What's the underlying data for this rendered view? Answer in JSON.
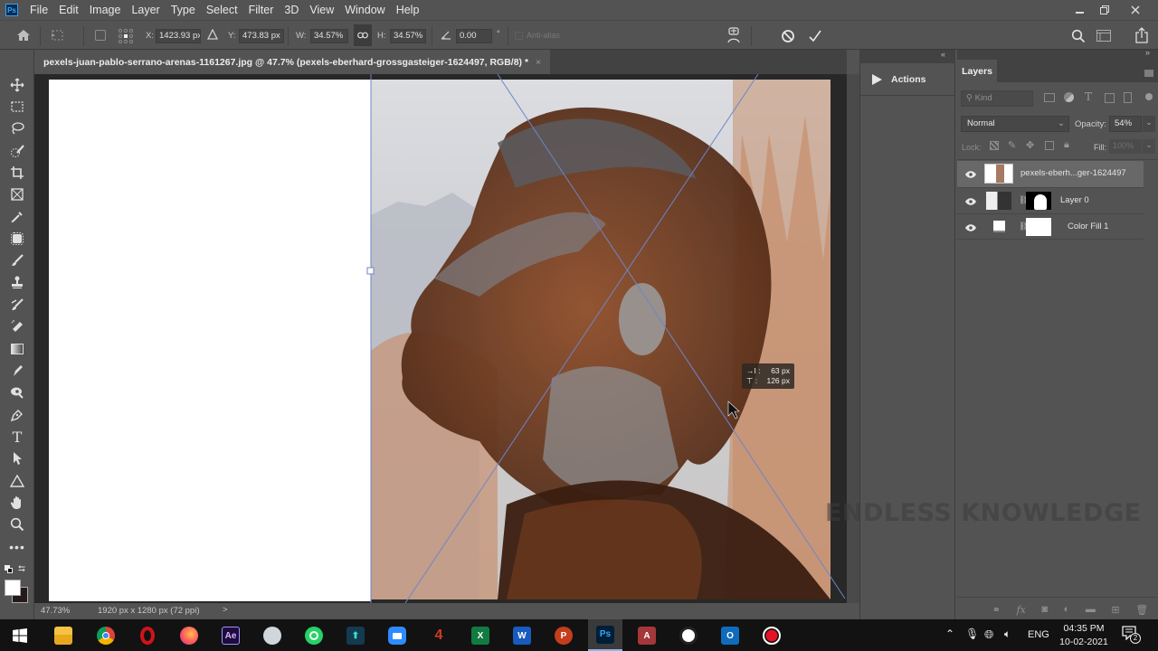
{
  "app": {
    "logo": "Ps",
    "menu": [
      "File",
      "Edit",
      "Image",
      "Layer",
      "Type",
      "Select",
      "Filter",
      "3D",
      "View",
      "Window",
      "Help"
    ],
    "window_controls": {
      "minimize": "minimize-icon",
      "restore": "restore-icon",
      "close": "close-icon"
    }
  },
  "options_bar": {
    "x_label": "X:",
    "x_value": "1423.93 px",
    "y_label": "Y:",
    "y_value": "473.83 px",
    "w_label": "W:",
    "w_value": "34.57%",
    "h_label": "H:",
    "h_value": "34.57%",
    "angle_value": "0.00",
    "angle_unit": "°",
    "anti_alias_label": "Anti-alias",
    "anti_alias_checked": false
  },
  "document": {
    "tab_title": "pexels-juan-pablo-serrano-arenas-1161267.jpg @ 47.7% (pexels-eberhard-grossgasteiger-1624497, RGB/8) *",
    "close_glyph": "×",
    "transform_tooltip": {
      "line1_label": "→I :",
      "line1_value": "63 px",
      "line2_label": "⊤ :",
      "line2_value": "126 px"
    }
  },
  "status_bar": {
    "zoom": "47.73%",
    "doc_size": "1920 px x 1280 px (72 ppi)",
    "arrow": ">"
  },
  "tools": [
    "move-tool",
    "marquee-tool",
    "lasso-tool",
    "quick-selection-tool",
    "crop-tool",
    "frame-tool",
    "eyedropper-tool",
    "spot-healing-tool",
    "brush-tool",
    "clone-stamp-tool",
    "history-brush-tool",
    "eraser-tool",
    "gradient-tool",
    "smudge-tool",
    "dodge-tool",
    "pen-tool",
    "type-tool",
    "path-selection-tool",
    "shape-tool",
    "hand-tool",
    "zoom-tool",
    "more-tools"
  ],
  "colors": {
    "foreground": "#ffffff",
    "background": "#231a1a",
    "accent_guide": "#6d86c8"
  },
  "actions_panel": {
    "title": "Actions"
  },
  "layers_panel": {
    "tab": "Layers",
    "filter_placeholder": "Kind",
    "blend_mode": "Normal",
    "opacity_label": "Opacity:",
    "opacity_value": "54%",
    "lock_label": "Lock:",
    "fill_label": "Fill:",
    "fill_value": "100%",
    "layers": [
      {
        "name": "pexels-eberh...ger-1624497",
        "visible": true,
        "selected": true,
        "type": "smart-object"
      },
      {
        "name": "Layer 0",
        "visible": true,
        "selected": false,
        "type": "masked"
      },
      {
        "name": "Color Fill 1",
        "visible": true,
        "selected": false,
        "type": "fill"
      }
    ],
    "footer_icons": [
      "link-icon",
      "fx-icon",
      "mask-icon",
      "adjustment-icon",
      "folder-icon",
      "new-layer-icon",
      "trash-icon"
    ]
  },
  "watermark": "ENDLESS KNOWLEDGE",
  "taskbar": {
    "apps": [
      {
        "name": "file-explorer",
        "label": ""
      },
      {
        "name": "chrome",
        "label": ""
      },
      {
        "name": "opera",
        "label": "O"
      },
      {
        "name": "firefox",
        "label": ""
      },
      {
        "name": "after-effects",
        "label": "Ae"
      },
      {
        "name": "app-6",
        "label": ""
      },
      {
        "name": "whatsapp",
        "label": ""
      },
      {
        "name": "app-8",
        "label": ""
      },
      {
        "name": "zoom",
        "label": ""
      },
      {
        "name": "app-10",
        "label": ""
      },
      {
        "name": "excel",
        "label": "X"
      },
      {
        "name": "word",
        "label": "W"
      },
      {
        "name": "powerpoint",
        "label": "P"
      },
      {
        "name": "photoshop",
        "label": "Ps"
      },
      {
        "name": "access",
        "label": "A"
      },
      {
        "name": "app-16",
        "label": ""
      },
      {
        "name": "outlook",
        "label": "O"
      },
      {
        "name": "recorder",
        "label": ""
      }
    ],
    "language": "ENG",
    "time": "04:35 PM",
    "date": "10-02-2021",
    "notification_count": "2"
  }
}
